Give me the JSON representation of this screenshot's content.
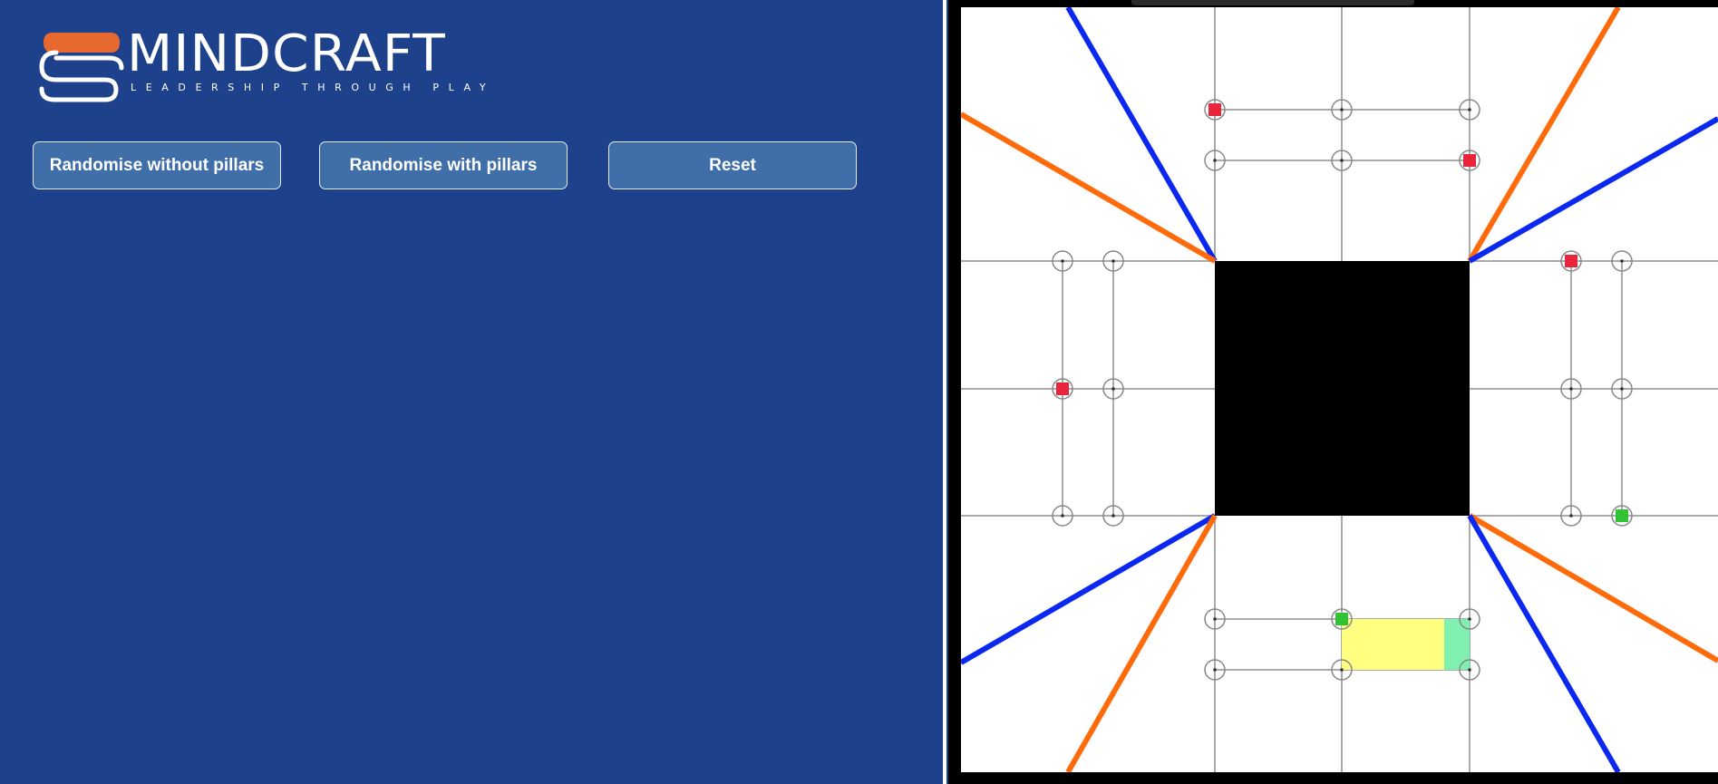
{
  "logo": {
    "wordmark": "MINDCRAFT",
    "tagline": "LEADERSHIP THROUGH PLAY",
    "colors": {
      "accent": "#e8692f",
      "outline": "#ffffff"
    }
  },
  "controls": {
    "randomise_without_pillars": "Randomise without pillars",
    "randomise_with_pillars": "Randomise with pillars",
    "reset": "Reset"
  },
  "board": {
    "colors": {
      "background": "#ffffff",
      "center_block": "#000000",
      "grid_line": "#aaaaaa",
      "blue_line": "#0a28f0",
      "orange_line": "#ff6a0a",
      "red_marker": "#e8253a",
      "green_marker": "#33c233",
      "highlight_yellow": "#ffff80",
      "highlight_green": "#7ff0b0"
    },
    "markers": {
      "red": [
        "top-row1-left",
        "top-row2-right",
        "right-col1-top",
        "left-col1-mid"
      ],
      "green": [
        "right-col2-bottom",
        "bottom-row1-mid"
      ]
    }
  }
}
